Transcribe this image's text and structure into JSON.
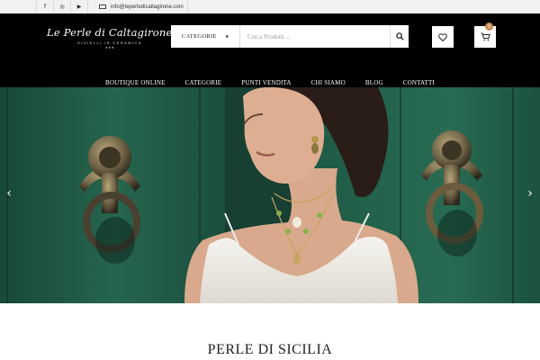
{
  "topbar": {
    "social": [
      {
        "name": "facebook-icon",
        "glyph": "f"
      },
      {
        "name": "instagram-icon",
        "glyph": "◎"
      },
      {
        "name": "youtube-icon",
        "glyph": "▶"
      }
    ],
    "email": "info@leperledicaltagirone.com"
  },
  "logo": {
    "name": "Le Perle di Caltagirone",
    "tagline": "GIOIELLI IN CERAMICA",
    "dots": "● ● ●"
  },
  "search": {
    "category_label": "CATEGORIE",
    "placeholder": "Cerca Prodotti ..."
  },
  "cart": {
    "count": "0"
  },
  "nav": {
    "items": [
      "BOUTIQUE ONLINE",
      "CATEGORIE",
      "PUNTI VENDITA",
      "CHI SIAMO",
      "BLOG",
      "CONTATTI"
    ]
  },
  "hero": {
    "prev_label": "‹",
    "next_label": "›"
  },
  "section": {
    "title": "PERLE DI SICILIA"
  },
  "colors": {
    "header_bg": "#000000",
    "accent": "#c88a52",
    "door_green": "#1e5a42"
  }
}
